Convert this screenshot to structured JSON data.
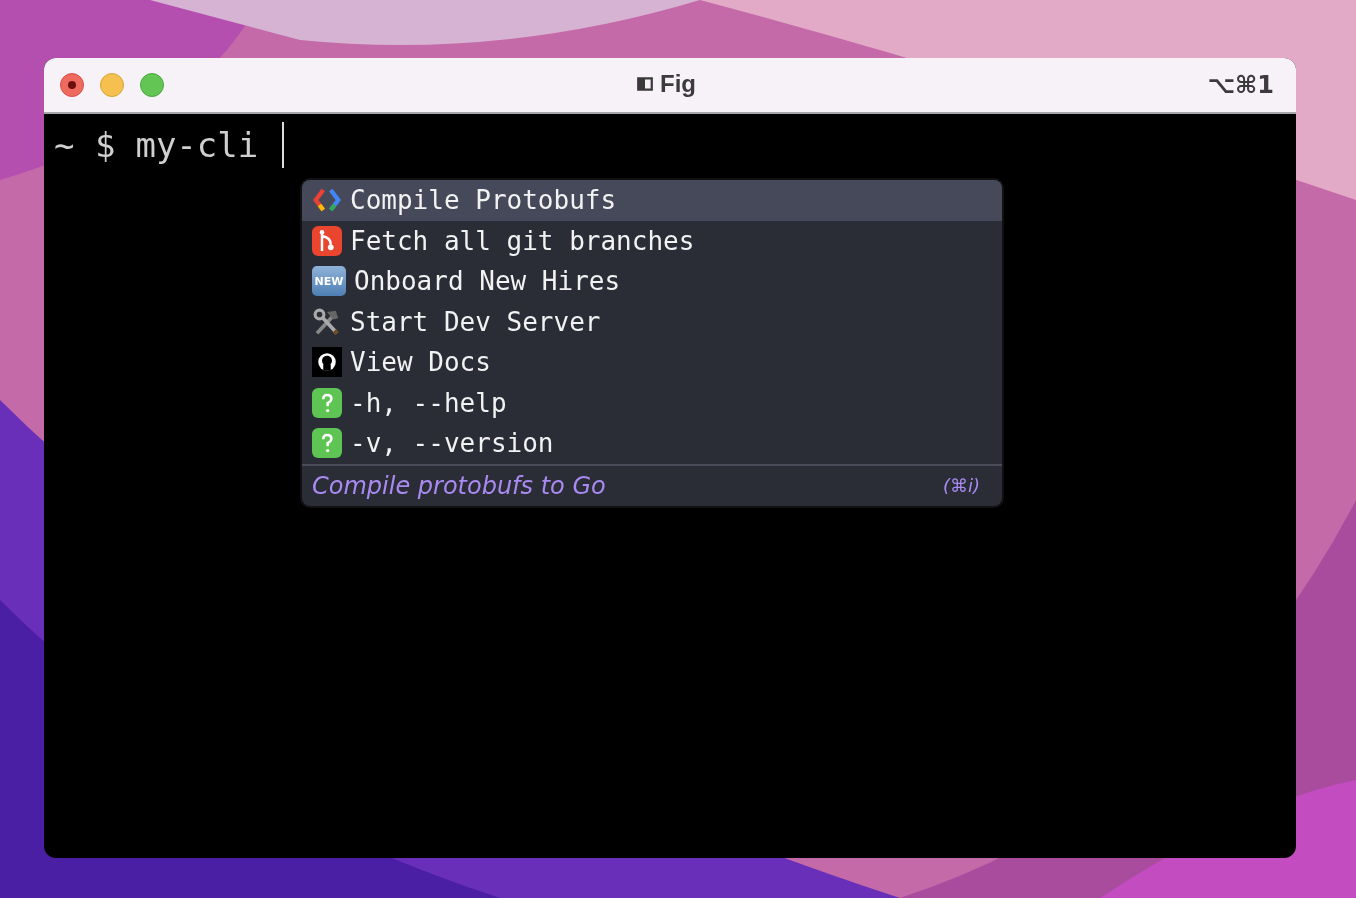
{
  "window": {
    "title": "Fig",
    "shortcut": "⌥⌘1"
  },
  "terminal": {
    "prompt": "~ $",
    "command": "my-cli"
  },
  "suggestions": [
    {
      "kind": "code",
      "label": "Compile Protobufs",
      "selected": true
    },
    {
      "kind": "git",
      "label": "Fetch all git branches",
      "selected": false
    },
    {
      "kind": "new",
      "badge": "NEW",
      "label": "Onboard New Hires",
      "selected": false
    },
    {
      "kind": "tools",
      "label": "Start Dev Server",
      "selected": false
    },
    {
      "kind": "github",
      "label": "View Docs",
      "selected": false
    },
    {
      "kind": "help",
      "label": "-h, --help",
      "selected": false
    },
    {
      "kind": "help",
      "label": "-v, --version",
      "selected": false
    }
  ],
  "description": {
    "text": "Compile protobufs to Go",
    "shortcut": "(⌘i)"
  }
}
